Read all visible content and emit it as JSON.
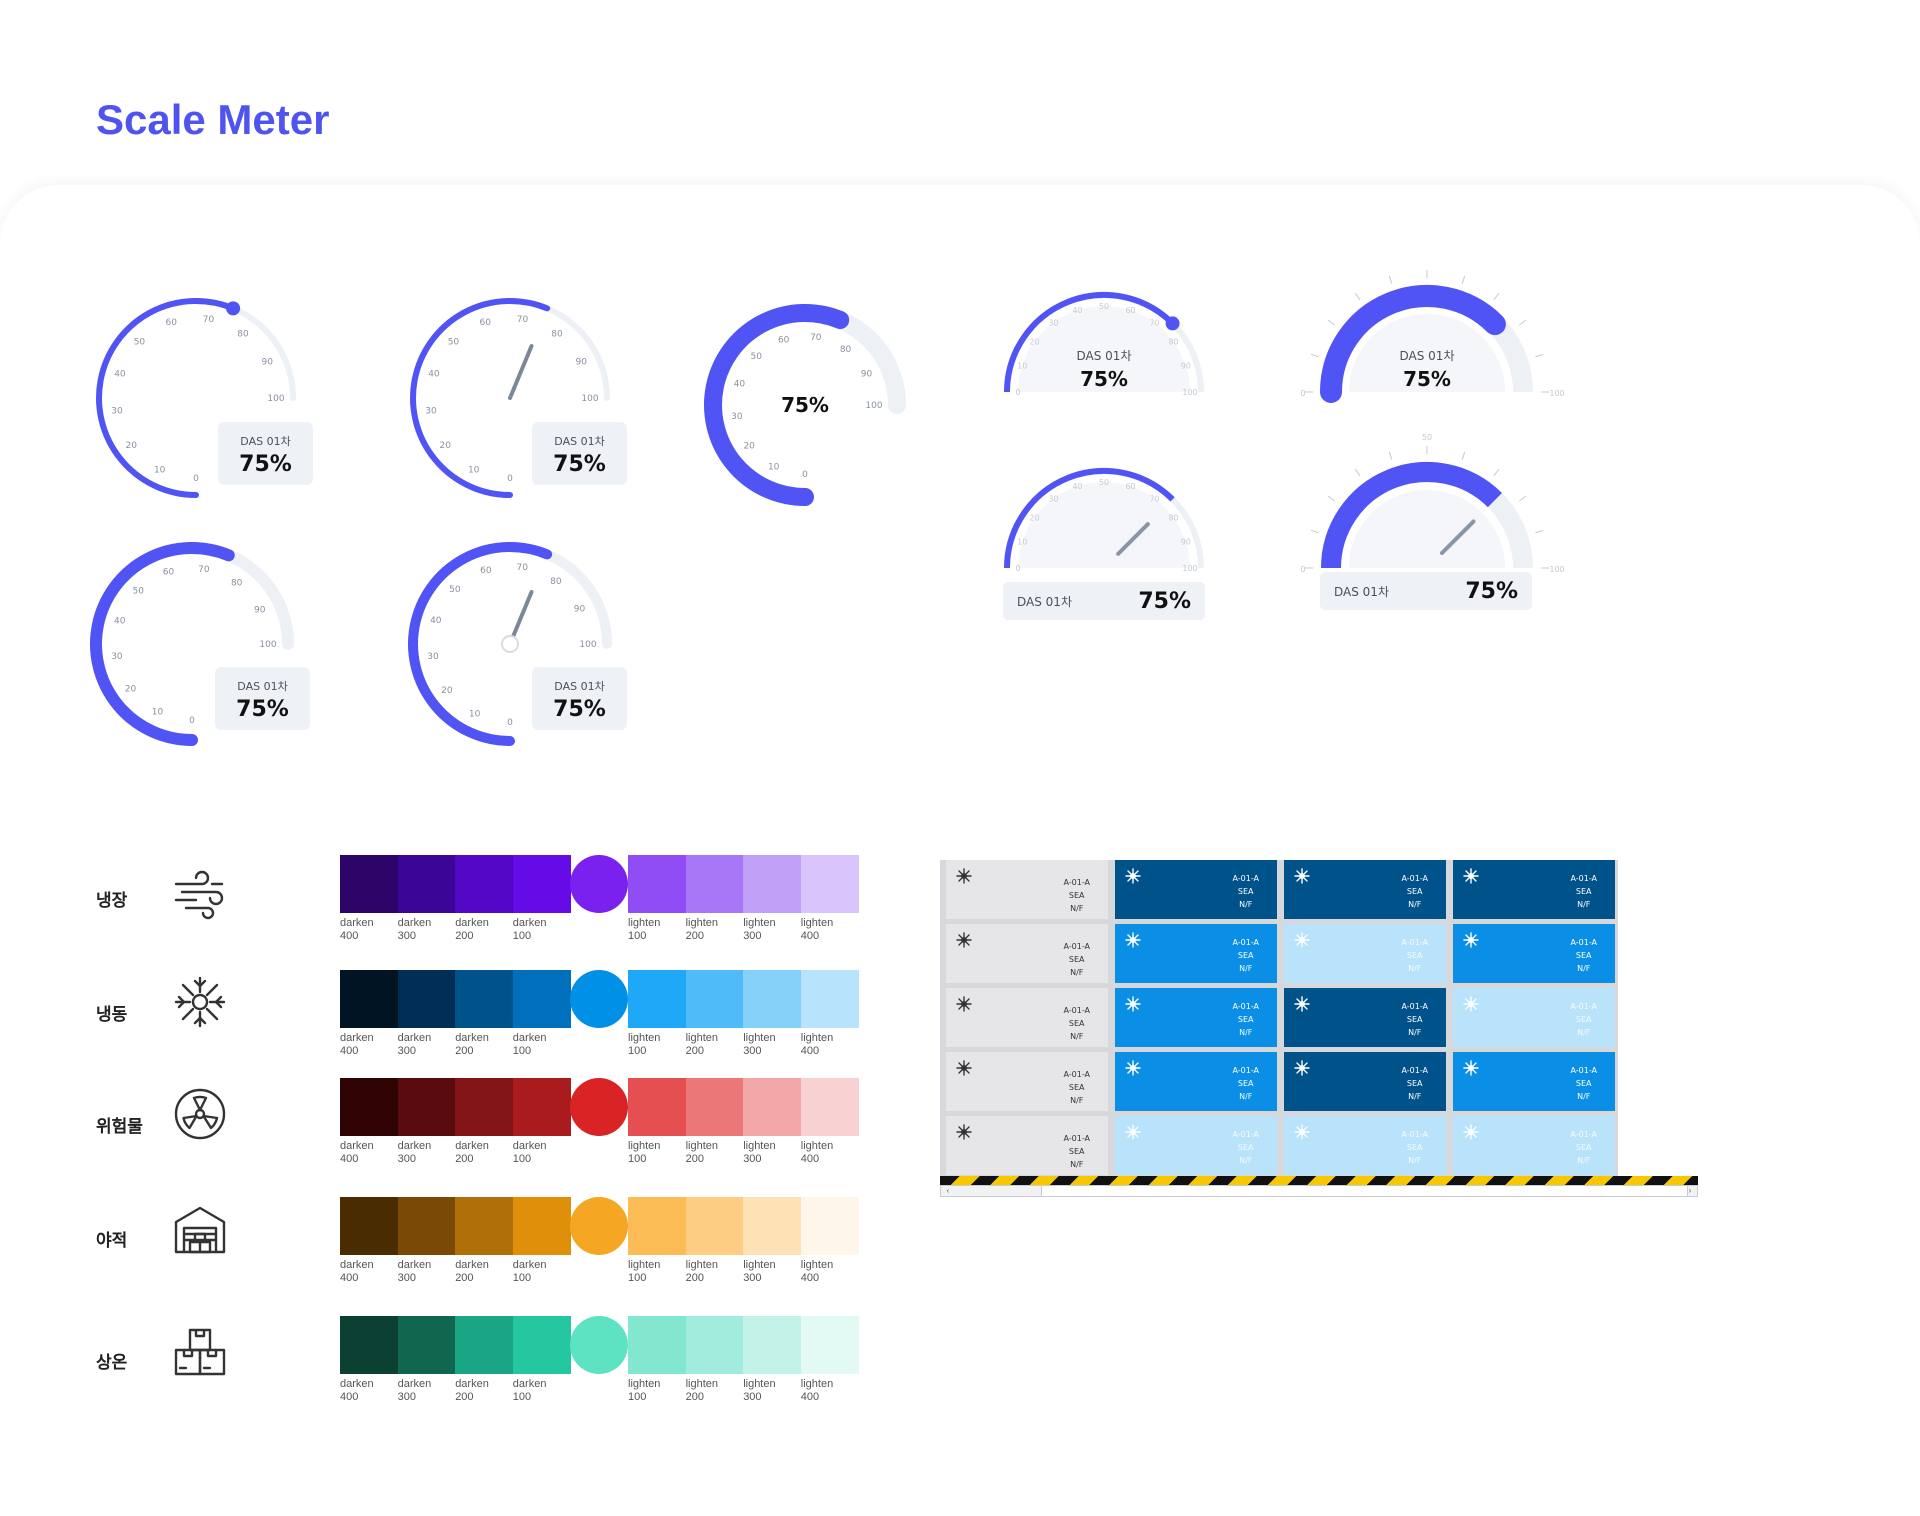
{
  "page": {
    "title": "Scale Meter"
  },
  "gauges": {
    "label": "DAS 01차",
    "value": "75%",
    "ticks_full": [
      "0",
      "10",
      "20",
      "30",
      "40",
      "50",
      "60",
      "70",
      "80",
      "90",
      "100"
    ],
    "ticks_half": [
      "0",
      "10",
      "20",
      "30",
      "40",
      "50",
      "60",
      "70",
      "80",
      "90",
      "100"
    ],
    "tick_50": "50",
    "accent": "#5154f4",
    "track": "#edf0f5"
  },
  "legend": {
    "categories": [
      {
        "label": "냉장",
        "icon": "wind-icon"
      },
      {
        "label": "냉동",
        "icon": "snowflake-icon"
      },
      {
        "label": "위험물",
        "icon": "radiation-icon"
      },
      {
        "label": "야적",
        "icon": "warehouse-icon"
      },
      {
        "label": "상온",
        "icon": "boxes-icon"
      }
    ],
    "shade_labels": [
      [
        "darken",
        "400"
      ],
      [
        "darken",
        "300"
      ],
      [
        "darken",
        "200"
      ],
      [
        "darken",
        "100"
      ],
      [
        "lighten",
        "100"
      ],
      [
        "lighten",
        "200"
      ],
      [
        "lighten",
        "300"
      ],
      [
        "lighten",
        "400"
      ]
    ],
    "palettes": [
      {
        "colors": [
          "#2d0468",
          "#3b0597",
          "#5207c4",
          "#650be8"
        ],
        "base": "#7a21f0",
        "light": [
          "#914df5",
          "#a877f7",
          "#c1a0f8",
          "#d9c5fb"
        ]
      },
      {
        "colors": [
          "#001424",
          "#002e54",
          "#00538a",
          "#0070bd"
        ],
        "base": "#0090e6",
        "light": [
          "#1fa8f7",
          "#4fbbf8",
          "#85d1fa",
          "#b8e3fc"
        ]
      },
      {
        "colors": [
          "#300405",
          "#5a0b0f",
          "#831417",
          "#aa1b1e"
        ],
        "base": "#d92325",
        "light": [
          "#e64f51",
          "#ec7779",
          "#f2a7a8",
          "#f8d2d3"
        ]
      },
      {
        "colors": [
          "#4a2c03",
          "#7a4a05",
          "#b06f07",
          "#e08f0b"
        ],
        "base": "#f5a623",
        "light": [
          "#fbbb55",
          "#fccd82",
          "#fde2b6",
          "#fef6e8"
        ]
      },
      {
        "colors": [
          "#0b4032",
          "#10664f",
          "#1aa584",
          "#25c7a0"
        ],
        "base": "#5de3c1",
        "light": [
          "#83e7d0",
          "#a1ecdc",
          "#c3f3e8",
          "#e3faf4"
        ]
      }
    ]
  },
  "rack": {
    "cell_lines": [
      "A-01-A",
      "SEA",
      "N/F"
    ],
    "colors": {
      "grey": "#e6e6e8",
      "dark": "#00528a",
      "mid": "#0a8ee6",
      "light": "#b9e2fb"
    },
    "grid": [
      [
        "grey",
        "dark",
        "dark",
        "dark"
      ],
      [
        "grey",
        "mid",
        "light",
        "mid"
      ],
      [
        "grey",
        "mid",
        "dark",
        "light"
      ],
      [
        "grey",
        "mid",
        "dark",
        "mid"
      ],
      [
        "grey",
        "light",
        "light",
        "light"
      ]
    ],
    "scroll_left_icon": "chevron-left-icon",
    "scroll_right_icon": "chevron-right-icon"
  }
}
